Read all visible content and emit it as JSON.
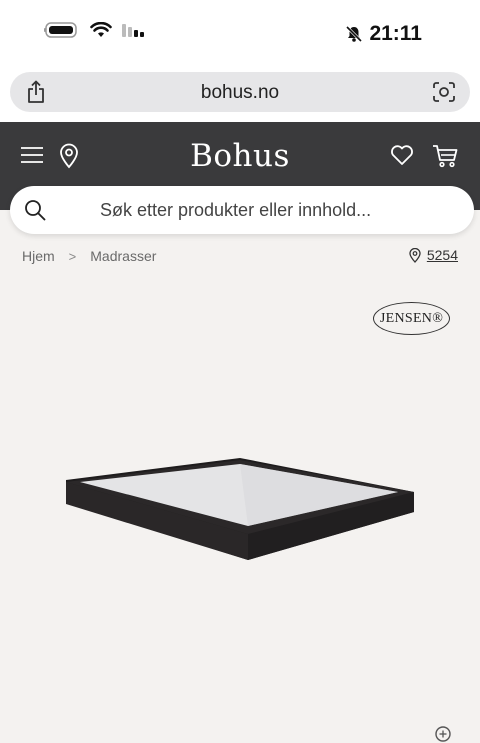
{
  "status": {
    "time": "21:11"
  },
  "browser": {
    "url": "bohus.no"
  },
  "header": {
    "logo": "Bohus"
  },
  "search": {
    "placeholder": "Søk etter produkter eller innhold..."
  },
  "breadcrumb": {
    "items": [
      "Hjem",
      "Madrasser"
    ],
    "separator": ">"
  },
  "store": {
    "code": "5254"
  },
  "product": {
    "brand": "JENSEN®"
  },
  "colors": {
    "header_bg": "#3a3a3c",
    "page_bg": "#f4f2f0",
    "url_bar_bg": "#e6e6e8"
  }
}
